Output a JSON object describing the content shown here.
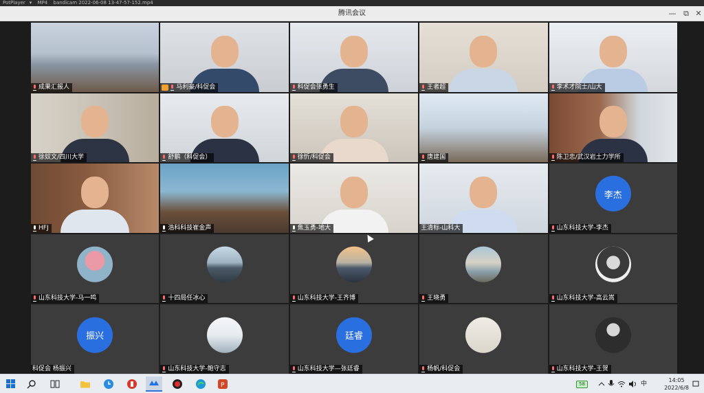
{
  "player": {
    "app": "PotPlayer",
    "menu_arrow": "▾",
    "format": "MP4",
    "file": "bandicam 2022-06-08 13-47-57-152.mp4"
  },
  "window": {
    "title": "腾讯会议",
    "minimize": "—",
    "restore": "⧉",
    "close": "✕"
  },
  "participants": [
    {
      "name": "成果汇报人",
      "mic": "muted"
    },
    {
      "name": "马利豪/科促会",
      "mic": "muted",
      "host": true
    },
    {
      "name": "科促会张勇生",
      "mic": "muted"
    },
    {
      "name": "王者超",
      "mic": "muted"
    },
    {
      "name": "李术才院士/山大",
      "mic": "muted"
    },
    {
      "name": "徐奴文/四川大学",
      "mic": "muted"
    },
    {
      "name": "舒鹏（科促会）",
      "mic": "muted"
    },
    {
      "name": "徐忻/科促会",
      "mic": "muted"
    },
    {
      "name": "唐建国",
      "mic": "muted"
    },
    {
      "name": "陈卫忠/武汉岩土力学所",
      "mic": "muted"
    },
    {
      "name": "HFJ",
      "mic": "on"
    },
    {
      "name": "浩科科技崔金声",
      "mic": "on"
    },
    {
      "name": "焦玉勇-地大",
      "mic": "on"
    },
    {
      "name": "王清标-山科大",
      "mic": "none"
    },
    {
      "name": "山东科技大学-李杰",
      "mic": "muted",
      "avatar_text": "李杰"
    },
    {
      "name": "山东科技大学-马一鸣",
      "mic": "muted"
    },
    {
      "name": "十四局任冰心",
      "mic": "muted"
    },
    {
      "name": "山东科技大学-王齐博",
      "mic": "muted"
    },
    {
      "name": "王晓勇",
      "mic": "muted"
    },
    {
      "name": "山东科技大学-高云嵩",
      "mic": "muted"
    },
    {
      "name": "科促会 杨振兴",
      "mic": "none",
      "avatar_text": "振兴"
    },
    {
      "name": "山东科技大学-鲍守志",
      "mic": "muted"
    },
    {
      "name": "山东科技大学—张廷睿",
      "mic": "muted",
      "avatar_text": "廷睿"
    },
    {
      "name": "杨帆/科促会",
      "mic": "muted"
    },
    {
      "name": "山东科技大学-王贺",
      "mic": "muted"
    }
  ],
  "taskbar": {
    "start_icon": "windows-icon",
    "battery": "58",
    "ime": "中",
    "time": "14:05",
    "date": "2022/6/8"
  }
}
